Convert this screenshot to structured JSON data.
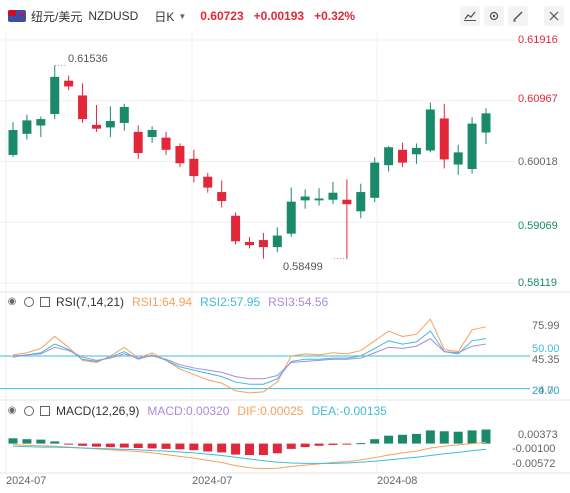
{
  "header": {
    "pair_label": "纽元/美元",
    "symbol": "NZDUSD",
    "period": "日K",
    "price": "0.60723",
    "change": "+0.00193",
    "change_pct": "+0.32%"
  },
  "toolbar": {
    "icons": [
      "line-chart-icon",
      "settings-icon",
      "draw-icon",
      "fullscreen-icon"
    ]
  },
  "colors": {
    "up": "#1a8a6b",
    "down": "#e0283a",
    "rsi1": "#f5a25d",
    "rsi2": "#3fbcd8",
    "rsi3": "#a98bdc",
    "macd": "#a98bdc",
    "dif": "#f5a25d",
    "dea": "#3fbcd8"
  },
  "main_panel": {
    "y_ticks": [
      "0.61916",
      "0.60967",
      "0.60018",
      "0.59069",
      "0.58119"
    ],
    "max_label": "0.61536",
    "min_label": "0.58499"
  },
  "rsi_panel": {
    "name": "RSI(7,14,21)",
    "rsi1": "RSI1:64.94",
    "rsi2": "RSI2:57.95",
    "rsi3": "RSI3:54.56",
    "y_ticks": [
      "75.99",
      "50.00",
      "45.35",
      "24.70",
      "20.00"
    ]
  },
  "macd_panel": {
    "name": "MACD(12,26,9)",
    "macd": "MACD:0.00320",
    "dif": "DIF:0.00025",
    "dea": "DEA:-0.00135",
    "y_ticks": [
      "0.00373",
      "-0.00100",
      "-0.00572"
    ]
  },
  "x_axis": [
    "2024-07",
    "2024-07",
    "2024-08"
  ],
  "chart_data": {
    "type": "candlestick",
    "ylim": [
      0.58119,
      0.61916
    ],
    "candles": [
      {
        "o": 0.6012,
        "h": 0.6063,
        "l": 0.6009,
        "c": 0.6051
      },
      {
        "o": 0.6045,
        "h": 0.6075,
        "l": 0.6036,
        "c": 0.6066
      },
      {
        "o": 0.6058,
        "h": 0.6072,
        "l": 0.604,
        "c": 0.6068
      },
      {
        "o": 0.6076,
        "h": 0.6152,
        "l": 0.6068,
        "c": 0.6134
      },
      {
        "o": 0.6128,
        "h": 0.6136,
        "l": 0.6113,
        "c": 0.6119
      },
      {
        "o": 0.6105,
        "h": 0.6124,
        "l": 0.6062,
        "c": 0.6068
      },
      {
        "o": 0.6059,
        "h": 0.609,
        "l": 0.6048,
        "c": 0.6053
      },
      {
        "o": 0.6055,
        "h": 0.6088,
        "l": 0.604,
        "c": 0.6065
      },
      {
        "o": 0.6062,
        "h": 0.6092,
        "l": 0.605,
        "c": 0.6087
      },
      {
        "o": 0.6048,
        "h": 0.6058,
        "l": 0.6006,
        "c": 0.6015
      },
      {
        "o": 0.604,
        "h": 0.6057,
        "l": 0.6031,
        "c": 0.6051
      },
      {
        "o": 0.6039,
        "h": 0.6048,
        "l": 0.6012,
        "c": 0.602
      },
      {
        "o": 0.6026,
        "h": 0.603,
        "l": 0.5993,
        "c": 0.5999
      },
      {
        "o": 0.6006,
        "h": 0.602,
        "l": 0.5969,
        "c": 0.5979
      },
      {
        "o": 0.5978,
        "h": 0.5984,
        "l": 0.5953,
        "c": 0.5961
      },
      {
        "o": 0.5954,
        "h": 0.5972,
        "l": 0.593,
        "c": 0.594
      },
      {
        "o": 0.5917,
        "h": 0.5922,
        "l": 0.5872,
        "c": 0.5877
      },
      {
        "o": 0.5876,
        "h": 0.5884,
        "l": 0.5866,
        "c": 0.5871
      },
      {
        "o": 0.5879,
        "h": 0.589,
        "l": 0.585,
        "c": 0.5868
      },
      {
        "o": 0.5868,
        "h": 0.5899,
        "l": 0.586,
        "c": 0.5886
      },
      {
        "o": 0.5889,
        "h": 0.5961,
        "l": 0.5884,
        "c": 0.5939
      },
      {
        "o": 0.5941,
        "h": 0.5958,
        "l": 0.5928,
        "c": 0.5947
      },
      {
        "o": 0.5941,
        "h": 0.596,
        "l": 0.5933,
        "c": 0.5944
      },
      {
        "o": 0.5942,
        "h": 0.597,
        "l": 0.5935,
        "c": 0.5953
      },
      {
        "o": 0.5942,
        "h": 0.5974,
        "l": 0.585,
        "c": 0.5935
      },
      {
        "o": 0.5924,
        "h": 0.5967,
        "l": 0.5913,
        "c": 0.5954
      },
      {
        "o": 0.5945,
        "h": 0.6008,
        "l": 0.5938,
        "c": 0.6
      },
      {
        "o": 0.5996,
        "h": 0.6026,
        "l": 0.5986,
        "c": 0.6024
      },
      {
        "o": 0.602,
        "h": 0.6031,
        "l": 0.5993,
        "c": 0.6
      },
      {
        "o": 0.6013,
        "h": 0.603,
        "l": 0.5998,
        "c": 0.6023
      },
      {
        "o": 0.6019,
        "h": 0.6094,
        "l": 0.6016,
        "c": 0.6083
      },
      {
        "o": 0.6069,
        "h": 0.6092,
        "l": 0.5991,
        "c": 0.6005
      },
      {
        "o": 0.5997,
        "h": 0.6028,
        "l": 0.5981,
        "c": 0.6016
      },
      {
        "o": 0.599,
        "h": 0.6071,
        "l": 0.5983,
        "c": 0.6061
      },
      {
        "o": 0.6047,
        "h": 0.6085,
        "l": 0.6029,
        "c": 0.6077
      }
    ],
    "rsi1": [
      51,
      53,
      57,
      68,
      58,
      46,
      44,
      50,
      58,
      48,
      53,
      46,
      38,
      33,
      28,
      25,
      18,
      16,
      17,
      26,
      50,
      52,
      51,
      53,
      52,
      55,
      64,
      73,
      68,
      70,
      84,
      56,
      54,
      74,
      77
    ],
    "rsi2": [
      49,
      51,
      53,
      61,
      56,
      47,
      45,
      49,
      54,
      47,
      51,
      46,
      40,
      37,
      34,
      31,
      26,
      24,
      24,
      29,
      45,
      47,
      47,
      48,
      48,
      50,
      57,
      64,
      61,
      63,
      73,
      54,
      52,
      64,
      66
    ],
    "rsi3": [
      50,
      51,
      52,
      58,
      55,
      49,
      46,
      48,
      52,
      48,
      50,
      47,
      42,
      39,
      37,
      35,
      31,
      29,
      29,
      32,
      44,
      45,
      46,
      47,
      47,
      48,
      53,
      58,
      57,
      59,
      66,
      54,
      53,
      59,
      61
    ],
    "macd_hist": [
      0.0012,
      0.001,
      0.0009,
      0.0005,
      -0.0002,
      -0.0005,
      -0.0007,
      -0.0008,
      -0.0009,
      -0.001,
      -0.0011,
      -0.0012,
      -0.0013,
      -0.0015,
      -0.0018,
      -0.002,
      -0.0025,
      -0.0026,
      -0.0026,
      -0.0022,
      -0.0012,
      -0.0008,
      -0.0005,
      -0.0003,
      -0.0002,
      0.0001,
      0.001,
      0.0018,
      0.002,
      0.0022,
      0.003,
      0.0028,
      0.0027,
      0.003,
      0.0032
    ],
    "dif": [
      -0.0002,
      -0.0004,
      -0.0005,
      -0.0006,
      -0.0008,
      -0.001,
      -0.0012,
      -0.0014,
      -0.0016,
      -0.0018,
      -0.0021,
      -0.0025,
      -0.0029,
      -0.0033,
      -0.0038,
      -0.0043,
      -0.005,
      -0.0055,
      -0.0057,
      -0.0056,
      -0.0052,
      -0.0049,
      -0.0046,
      -0.0043,
      -0.0041,
      -0.0037,
      -0.0032,
      -0.0026,
      -0.0021,
      -0.0017,
      -0.001,
      -0.0006,
      -0.0003,
      0.0,
      0.0003
    ],
    "dea": [
      -0.0006,
      -0.0007,
      -0.0008,
      -0.0008,
      -0.0009,
      -0.001,
      -0.0011,
      -0.0012,
      -0.0013,
      -0.0014,
      -0.0016,
      -0.0017,
      -0.0019,
      -0.0021,
      -0.0024,
      -0.0027,
      -0.0031,
      -0.0035,
      -0.0039,
      -0.0042,
      -0.0044,
      -0.0045,
      -0.0045,
      -0.0045,
      -0.0044,
      -0.0042,
      -0.004,
      -0.0037,
      -0.0034,
      -0.0031,
      -0.0027,
      -0.0023,
      -0.002,
      -0.0016,
      -0.0013
    ]
  }
}
